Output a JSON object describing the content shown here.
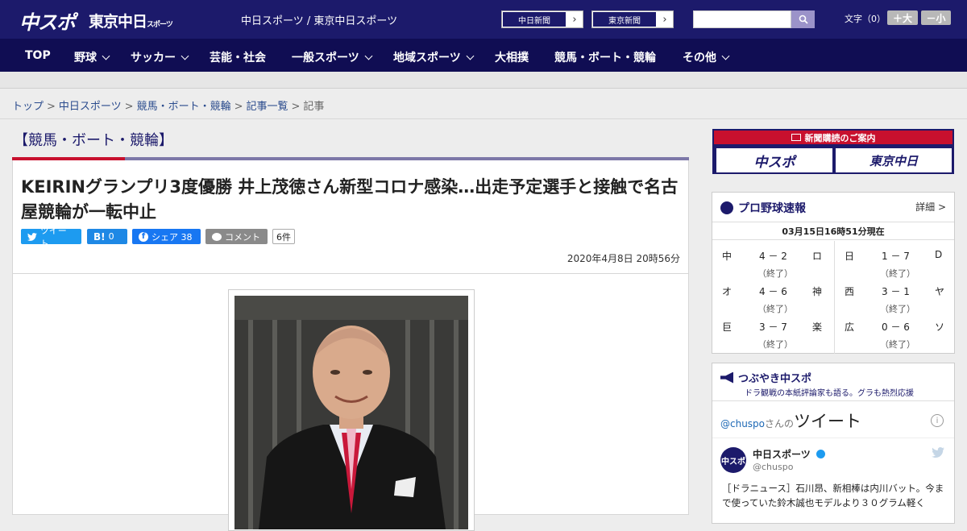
{
  "header": {
    "logo_chuspo": "中スポ",
    "logo_tokyo": "東京中日",
    "logo_tokyo_small": "スポーツ",
    "site_name": "中日スポーツ / 東京中日スポーツ",
    "paper_buttons": [
      "中日新聞",
      "東京新聞"
    ],
    "search_placeholder": "",
    "font_size_label": "文字（0）",
    "font_increase": "＋大",
    "font_decrease": "－小"
  },
  "nav": {
    "items": [
      "TOP",
      "野球",
      "サッカー",
      "芸能・社会",
      "一般スポーツ",
      "地域スポーツ",
      "大相撲",
      "競馬・ボート・競輪",
      "その他"
    ]
  },
  "breadcrumb": [
    "トップ",
    "中日スポーツ",
    "競馬・ボート・競輪",
    "記事一覧",
    "記事"
  ],
  "article": {
    "category": "【競馬・ボート・競輪】",
    "headline": "KEIRINグランプリ3度優勝 井上茂徳さん新型コロナ感染…出走予定選手と接触で名古屋競輪が一転中止",
    "share": {
      "tweet": "ツイート",
      "hatena_count": "0",
      "facebook": "シェア 38",
      "comment": "コメント",
      "comment_count": "6件"
    },
    "date": "2020年4月8日 20時56分"
  },
  "sidebar": {
    "subscribe": {
      "title": "新聞購読のご案内",
      "btn1": "中スポ",
      "btn2": "東京中日"
    },
    "baseball": {
      "title": "プロ野球速報",
      "more": "詳細 >",
      "time": "03月15日16時51分現在",
      "games_left": [
        {
          "away": "中",
          "score": "4 － 2",
          "home": "ロ",
          "status": "（終了）"
        },
        {
          "away": "オ",
          "score": "4 － 6",
          "home": "神",
          "status": "（終了）"
        },
        {
          "away": "巨",
          "score": "3 － 7",
          "home": "楽",
          "status": "（終了）"
        }
      ],
      "games_right": [
        {
          "away": "日",
          "score": "1 － 7",
          "home": "D",
          "status": "（終了）"
        },
        {
          "away": "西",
          "score": "3 － 1",
          "home": "ヤ",
          "status": "（終了）"
        },
        {
          "away": "広",
          "score": "0 － 6",
          "home": "ソ",
          "status": "（終了）"
        }
      ]
    },
    "tweets": {
      "title": "つぶやき中スポ",
      "subtitle": "ドラ観戦の本紙評論家も語る。グラも熱烈応援",
      "handle_prefix": "@chuspo",
      "handle_suffix": "さんの",
      "heading": "ツイート",
      "info": "i",
      "account_name": "中日スポーツ",
      "account_handle": "@chuspo",
      "avatar_text": "中スポ",
      "body": "［ドラニュース］石川昂、新相棒は内川バット。今まで使っていた鈴木誠也モデルより３０グラム軽く"
    }
  },
  "colors": {
    "header_bg": "#1c1a6b",
    "nav_bg": "#100d53",
    "accent_red": "#c8102e",
    "twitter": "#1d9bf0",
    "facebook": "#1877f2"
  }
}
